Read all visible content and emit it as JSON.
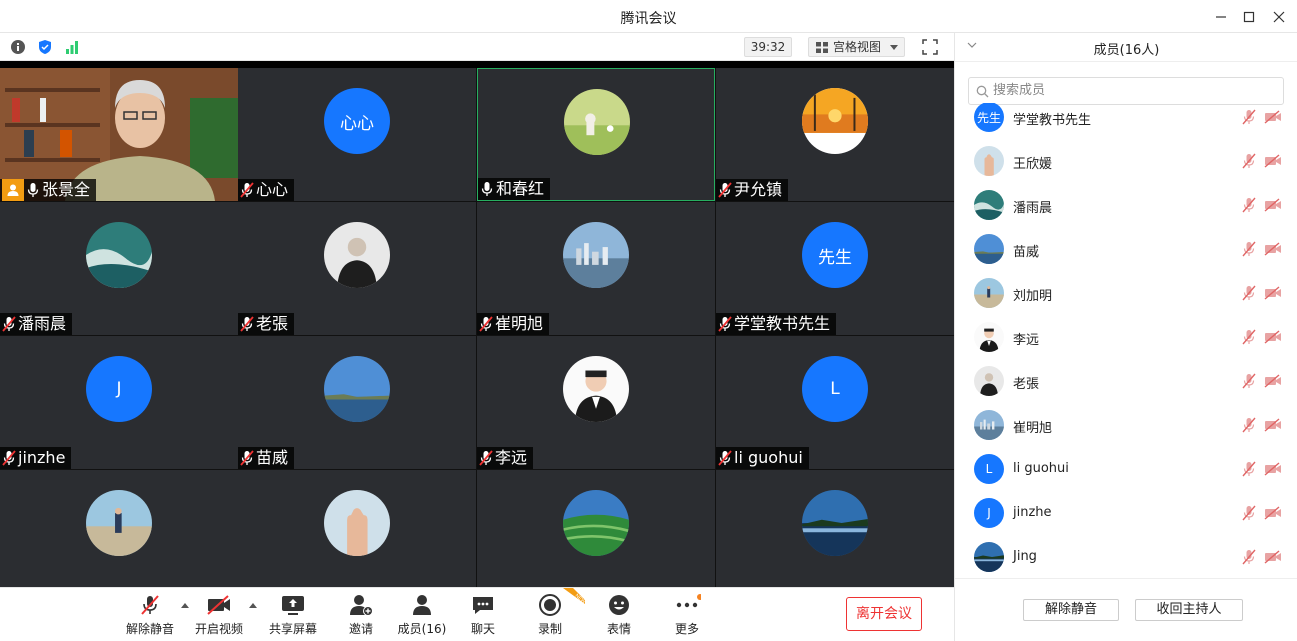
{
  "window": {
    "title": "腾讯会议"
  },
  "toolbar": {
    "timer": "39:32",
    "view_label": "宫格视图"
  },
  "tiles": [
    {
      "name": "张景全",
      "avatar_text": "",
      "avatar": "video",
      "host": true,
      "muted": false
    },
    {
      "name": "心心",
      "avatar_text": "心心",
      "avatar": "blue",
      "host": false,
      "muted": true
    },
    {
      "name": "和春红",
      "avatar_text": "",
      "avatar": "photo-field",
      "host": false,
      "muted": false,
      "active": true
    },
    {
      "name": "尹允镇",
      "avatar_text": "",
      "avatar": "photo-sunset",
      "host": false,
      "muted": true
    },
    {
      "name": "潘雨晨",
      "avatar_text": "",
      "avatar": "photo-ocean",
      "host": false,
      "muted": true
    },
    {
      "name": "老張",
      "avatar_text": "",
      "avatar": "photo-man-dark",
      "host": false,
      "muted": true
    },
    {
      "name": "崔明旭",
      "avatar_text": "",
      "avatar": "photo-city",
      "host": false,
      "muted": true
    },
    {
      "name": "学堂教书先生",
      "avatar_text": "先生",
      "avatar": "blue",
      "host": false,
      "muted": true
    },
    {
      "name": "jinzhe",
      "avatar_text": "J",
      "avatar": "blue",
      "host": false,
      "muted": true
    },
    {
      "name": "苗威",
      "avatar_text": "",
      "avatar": "photo-sky-sea",
      "host": false,
      "muted": true
    },
    {
      "name": "李远",
      "avatar_text": "",
      "avatar": "photo-man-suit",
      "host": false,
      "muted": true
    },
    {
      "name": "li guohui",
      "avatar_text": "L",
      "avatar": "blue",
      "host": false,
      "muted": true
    },
    {
      "name": "",
      "avatar_text": "",
      "avatar": "photo-beach-man",
      "host": false,
      "muted": true
    },
    {
      "name": "",
      "avatar_text": "",
      "avatar": "photo-hand",
      "host": false,
      "muted": true
    },
    {
      "name": "",
      "avatar_text": "",
      "avatar": "photo-tea",
      "host": false,
      "muted": true
    },
    {
      "name": "",
      "avatar_text": "",
      "avatar": "photo-lake",
      "host": false,
      "muted": true
    }
  ],
  "bottombar": {
    "mute": "解除静音",
    "video": "开启视频",
    "share": "共享屏幕",
    "invite": "邀请",
    "members": "成员(16)",
    "chat": "聊天",
    "record": "录制",
    "emoji": "表情",
    "more": "更多",
    "leave": "离开会议"
  },
  "panel": {
    "title": "成员(16人)",
    "search_placeholder": "搜索成员",
    "members": [
      {
        "name": "学堂教书先生",
        "avatar_text": "先生",
        "avatar": "blue"
      },
      {
        "name": "王欣媛",
        "avatar_text": "",
        "avatar": "photo-hand"
      },
      {
        "name": "潘雨晨",
        "avatar_text": "",
        "avatar": "photo-ocean"
      },
      {
        "name": "苗威",
        "avatar_text": "",
        "avatar": "photo-sky-sea"
      },
      {
        "name": "刘加明",
        "avatar_text": "",
        "avatar": "photo-beach-man"
      },
      {
        "name": "李远",
        "avatar_text": "",
        "avatar": "photo-man-suit"
      },
      {
        "name": "老張",
        "avatar_text": "",
        "avatar": "photo-man-dark"
      },
      {
        "name": "崔明旭",
        "avatar_text": "",
        "avatar": "photo-city"
      },
      {
        "name": "li guohui",
        "avatar_text": "L",
        "avatar": "blue"
      },
      {
        "name": "jinzhe",
        "avatar_text": "J",
        "avatar": "blue"
      },
      {
        "name": "Jing",
        "avatar_text": "",
        "avatar": "photo-lake"
      }
    ],
    "unmute_all": "解除静音",
    "reclaim_host": "收回主持人"
  },
  "colors": {
    "accent": "#1677ff",
    "leave": "#e33333",
    "host": "#f39c12",
    "active_border": "#27ae60"
  }
}
